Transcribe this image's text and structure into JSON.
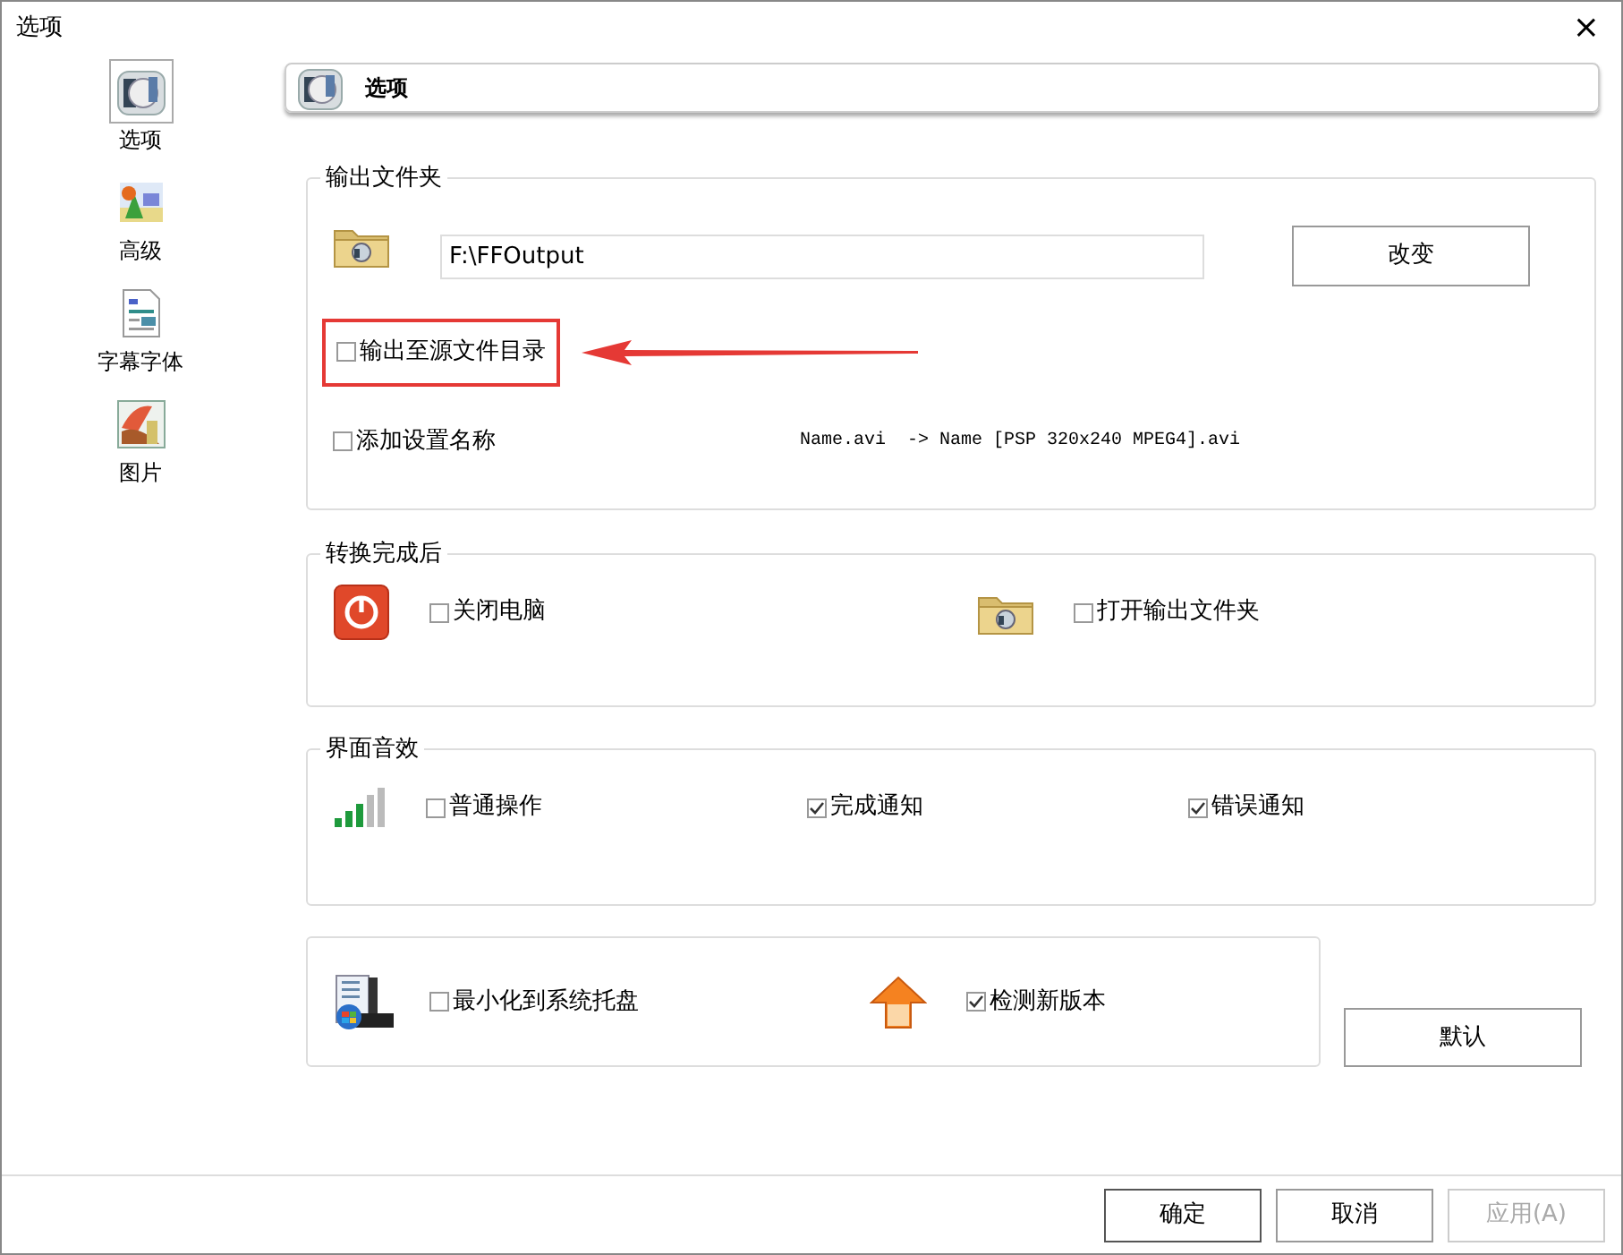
{
  "window": {
    "title": "选项",
    "close": "×"
  },
  "sidebar": {
    "items": [
      {
        "label": "选项",
        "kind": "options",
        "selected": true
      },
      {
        "label": "高级",
        "kind": "advanced",
        "selected": false
      },
      {
        "label": "字幕字体",
        "kind": "subtitle",
        "selected": false
      },
      {
        "label": "图片",
        "kind": "picture",
        "selected": false
      }
    ]
  },
  "header": {
    "title": "选项"
  },
  "output_folder": {
    "legend": "输出文件夹",
    "path": "F:\\FFOutput",
    "change_button": "改变",
    "options": [
      {
        "label": "输出至源文件目录",
        "checked": false,
        "highlighted": true
      },
      {
        "label": "添加设置名称",
        "checked": false
      }
    ],
    "name_example": "Name.avi  -> Name [PSP 320x240 MPEG4].avi"
  },
  "after_conversion": {
    "legend": "转换完成后",
    "options": [
      {
        "label": "关闭电脑",
        "checked": false,
        "kind": "power"
      },
      {
        "label": "打开输出文件夹",
        "checked": false,
        "kind": "folder"
      }
    ]
  },
  "sound": {
    "legend": "界面音效",
    "options": [
      {
        "label": "普通操作",
        "checked": false
      },
      {
        "label": "完成通知",
        "checked": true
      },
      {
        "label": "错误通知",
        "checked": true
      }
    ]
  },
  "misc": {
    "options": [
      {
        "label": "最小化到系统托盘",
        "checked": false,
        "kind": "tray"
      },
      {
        "label": "检测新版本",
        "checked": true,
        "kind": "update"
      }
    ]
  },
  "default_button": "默认",
  "buttons": [
    {
      "label": "确定",
      "disabled": false
    },
    {
      "label": "取消",
      "disabled": false
    },
    {
      "label": "应用(A)",
      "disabled": true
    }
  ]
}
